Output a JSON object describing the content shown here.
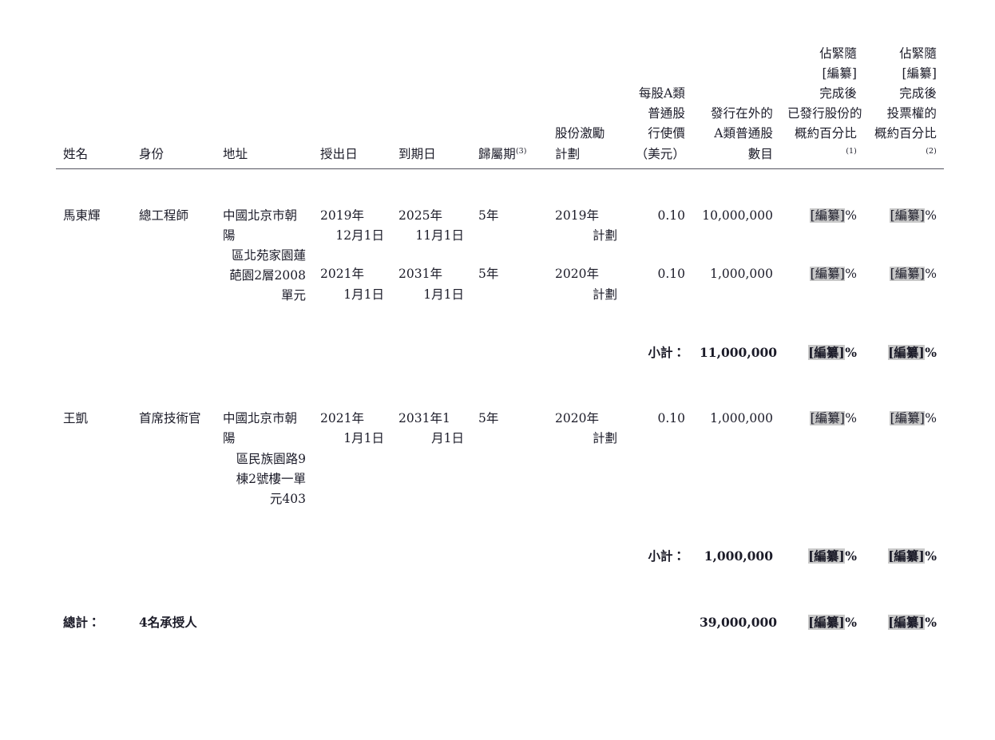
{
  "table": {
    "headers": [
      {
        "id": "name",
        "lines": [
          "姓名"
        ],
        "align": "left"
      },
      {
        "id": "identity",
        "lines": [
          "身份"
        ],
        "align": "left"
      },
      {
        "id": "address",
        "lines": [
          "地址"
        ],
        "align": "left"
      },
      {
        "id": "grant_date",
        "lines": [
          "授出日"
        ],
        "align": "left"
      },
      {
        "id": "expiry_date",
        "lines": [
          "到期日"
        ],
        "align": "left"
      },
      {
        "id": "vesting_period",
        "lines": [
          "歸屬期"
        ],
        "footnote": "(3)",
        "align": "left"
      },
      {
        "id": "share_plan",
        "lines": [
          "股份激勵",
          "計劃"
        ],
        "align": "left"
      },
      {
        "id": "exercise_price",
        "lines": [
          "每股A類",
          "普通股",
          "行使價",
          "（美元）"
        ],
        "align": "right"
      },
      {
        "id": "shares_out",
        "lines": [
          "發行在外的",
          "A類普通股",
          "數目"
        ],
        "align": "right"
      },
      {
        "id": "pct_shares",
        "lines": [
          "佔緊隨[編纂]",
          "完成後",
          "已發行股份的",
          "概約百分比"
        ],
        "footnote": "(1)",
        "align": "right"
      },
      {
        "id": "pct_votes",
        "lines": [
          "佔緊隨[編纂]",
          "完成後",
          "投票權的",
          "概約百分比"
        ],
        "footnote": "(2)",
        "align": "right"
      }
    ],
    "groups": [
      {
        "name": "馬東輝",
        "identity": "總工程師",
        "address_lines": [
          "中國北京市朝陽",
          "區北苑家園蓮",
          "葩園2層2008",
          "單元"
        ],
        "rows": [
          {
            "grant_date_lines": [
              "2019年",
              "12月1日"
            ],
            "expiry_date_lines": [
              "2025年",
              "11月1日"
            ],
            "vesting_period": "5年",
            "share_plan_lines": [
              "2019年",
              "計劃"
            ],
            "exercise_price": "0.10",
            "shares_out": "10,000,000",
            "pct_shares": "[編纂]%",
            "pct_votes": "[編纂]%"
          },
          {
            "grant_date_lines": [
              "2021年",
              "1月1日"
            ],
            "expiry_date_lines": [
              "2031年",
              "1月1日"
            ],
            "vesting_period": "5年",
            "share_plan_lines": [
              "2020年",
              "計劃"
            ],
            "exercise_price": "0.10",
            "shares_out": "1,000,000",
            "pct_shares": "[編纂]%",
            "pct_votes": "[編纂]%"
          }
        ],
        "subtotal": {
          "label": "小計：",
          "shares_out": "11,000,000",
          "pct_shares": "[編纂]%",
          "pct_votes": "[編纂]%"
        }
      },
      {
        "name": "王凱",
        "identity": "首席技術官",
        "address_lines": [
          "中國北京市朝陽",
          "區民族園路9",
          "棟2號樓一單",
          "元403"
        ],
        "rows": [
          {
            "grant_date_lines": [
              "2021年",
              "1月1日"
            ],
            "expiry_date_lines": [
              "2031年1",
              "月1日"
            ],
            "vesting_period": "5年",
            "share_plan_lines": [
              "2020年",
              "計劃"
            ],
            "exercise_price": "0.10",
            "shares_out": "1,000,000",
            "pct_shares": "[編纂]%",
            "pct_votes": "[編纂]%"
          }
        ],
        "subtotal": {
          "label": "小計：",
          "shares_out": "1,000,000",
          "pct_shares": "[編纂]%",
          "pct_votes": "[編纂]%"
        }
      }
    ],
    "total": {
      "label": "總計：",
      "grantees": "4名承授人",
      "shares_out": "39,000,000",
      "pct_shares": "[編纂]%",
      "pct_votes": "[編纂]%"
    }
  },
  "colors": {
    "text": "#1b1b28",
    "rule": "#54545f",
    "redaction_highlight": "#c9c9c9"
  }
}
